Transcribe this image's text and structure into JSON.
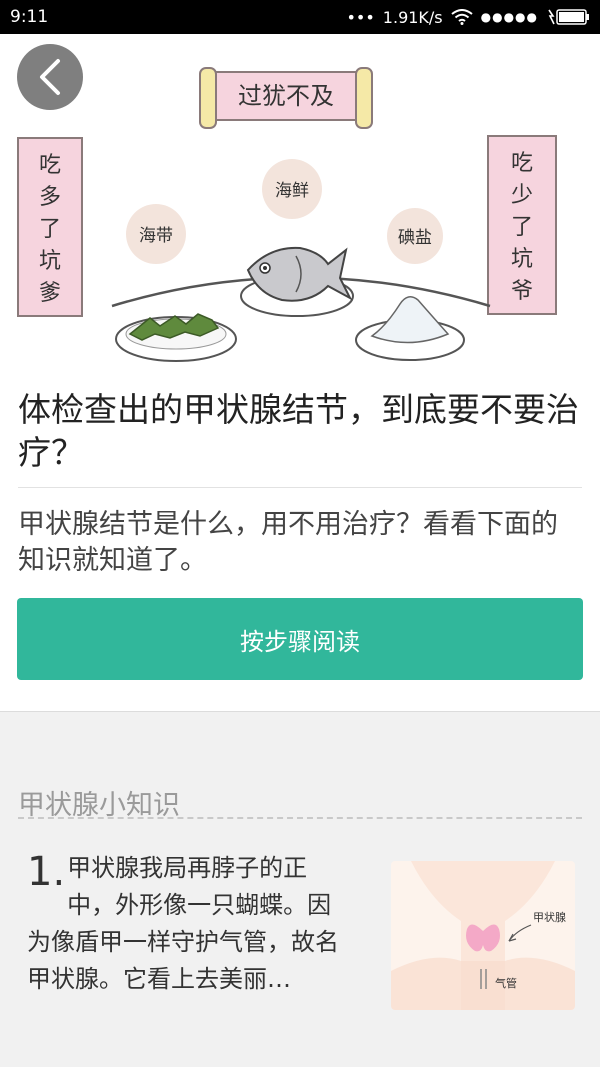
{
  "status": {
    "time": "9:11",
    "dots": "•••",
    "speed": "1.91K/s",
    "signal_dots": "●●●●●"
  },
  "hero": {
    "banner_top": "过犹不及",
    "scroll_left": "吃多了坑爹",
    "scroll_right": "吃少了坑爷",
    "bubble_left": "海带",
    "bubble_mid": "海鲜",
    "bubble_right": "碘盐"
  },
  "article": {
    "title": "体检查出的甲状腺结节，到底要不要治疗？",
    "description": "甲状腺结节是什么，用不用治疗？看看下面的知识就知道了。",
    "cta_label": "按步骤阅读"
  },
  "knowledge": {
    "section_title": "甲状腺小知识",
    "tip_number": "1.",
    "tip_text": "甲状腺我局再脖子的正中，外形像一只蝴蝶。因为像盾甲一样守护气管，故名甲状腺。它看上去美丽…",
    "thumb_label_gland": "甲状腺",
    "thumb_label_trachea": "气管"
  },
  "colors": {
    "accent": "#31b79b",
    "scroll_pink": "#f6d4de",
    "bubble": "#f3e4dc"
  }
}
